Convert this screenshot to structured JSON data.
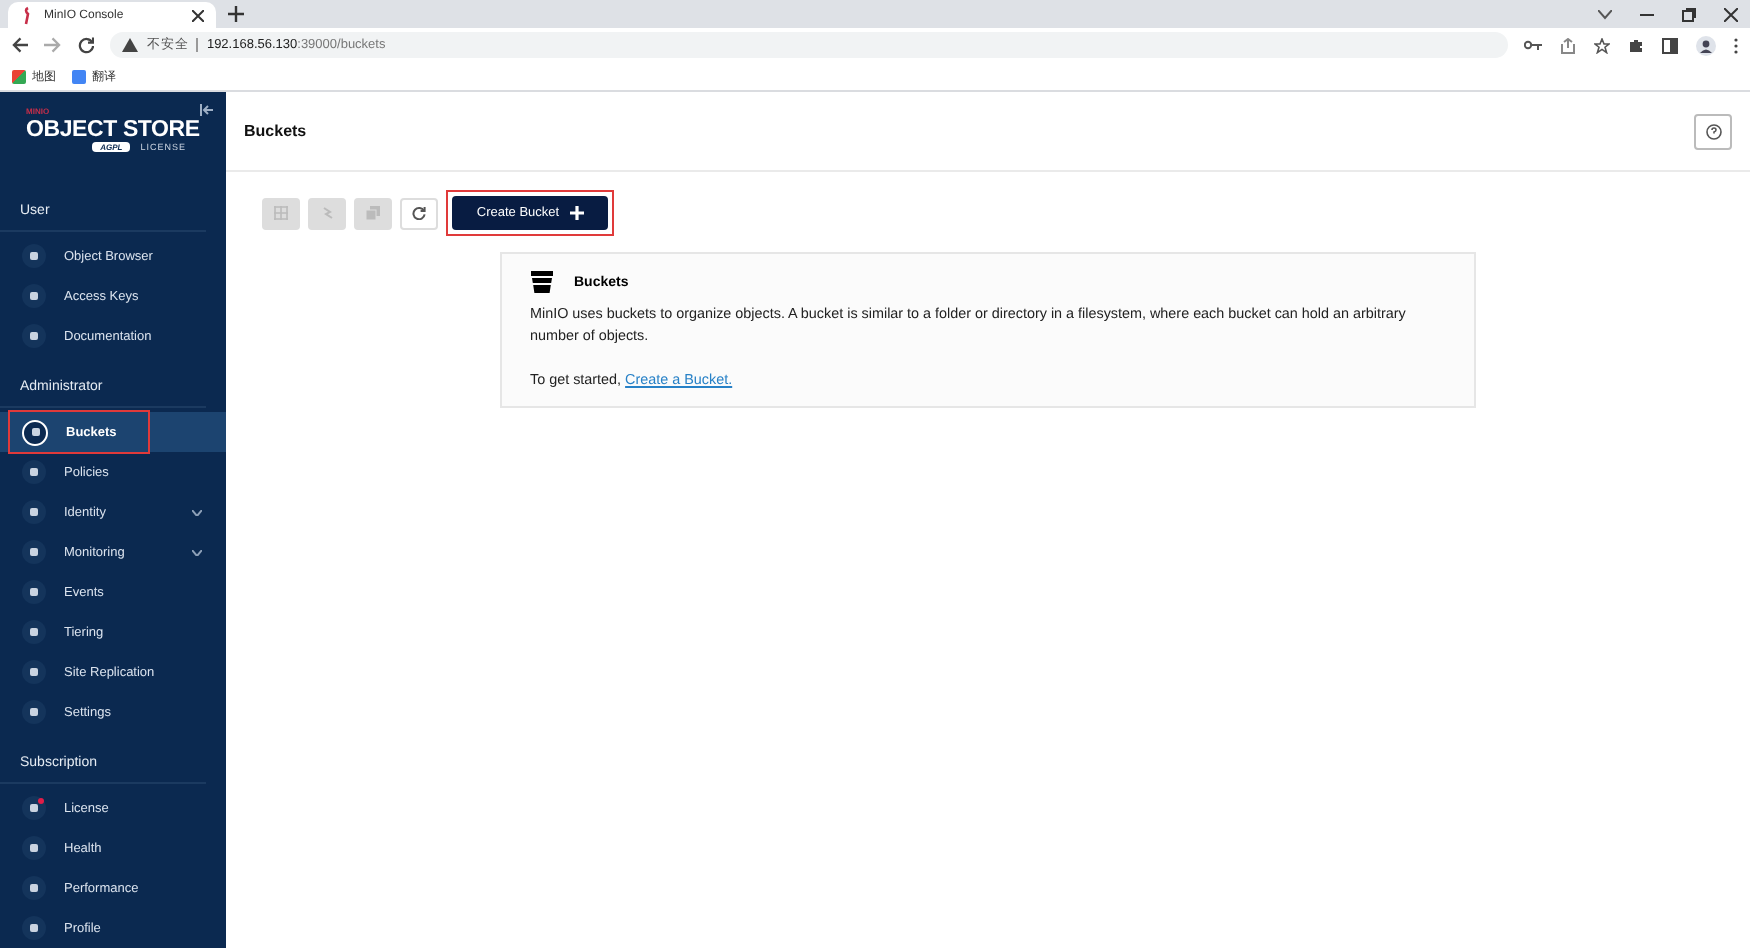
{
  "browser": {
    "tab_title": "MinIO Console",
    "security_label": "不安全",
    "url_host": "192.168.56.130",
    "url_rest": ":39000/buckets",
    "bookmarks": [
      {
        "label": "地图"
      },
      {
        "label": "翻译"
      }
    ]
  },
  "sidebar": {
    "brand_top": "MINIO",
    "brand_title": "OBJECT STORE",
    "brand_badge": "AGPL",
    "brand_sub": "LICENSE",
    "sections": [
      {
        "title": "User",
        "items": [
          {
            "label": "Object Browser",
            "selected": false,
            "expandable": false,
            "badge": false,
            "annotated": false
          },
          {
            "label": "Access Keys",
            "selected": false,
            "expandable": false,
            "badge": false,
            "annotated": false
          },
          {
            "label": "Documentation",
            "selected": false,
            "expandable": false,
            "badge": false,
            "annotated": false
          }
        ]
      },
      {
        "title": "Administrator",
        "items": [
          {
            "label": "Buckets",
            "selected": true,
            "expandable": false,
            "badge": false,
            "annotated": true
          },
          {
            "label": "Policies",
            "selected": false,
            "expandable": false,
            "badge": false,
            "annotated": false
          },
          {
            "label": "Identity",
            "selected": false,
            "expandable": true,
            "badge": false,
            "annotated": false
          },
          {
            "label": "Monitoring",
            "selected": false,
            "expandable": true,
            "badge": false,
            "annotated": false
          },
          {
            "label": "Events",
            "selected": false,
            "expandable": false,
            "badge": false,
            "annotated": false
          },
          {
            "label": "Tiering",
            "selected": false,
            "expandable": false,
            "badge": false,
            "annotated": false
          },
          {
            "label": "Site Replication",
            "selected": false,
            "expandable": false,
            "badge": false,
            "annotated": false
          },
          {
            "label": "Settings",
            "selected": false,
            "expandable": false,
            "badge": false,
            "annotated": false
          }
        ]
      },
      {
        "title": "Subscription",
        "items": [
          {
            "label": "License",
            "selected": false,
            "expandable": false,
            "badge": true,
            "annotated": false
          },
          {
            "label": "Health",
            "selected": false,
            "expandable": false,
            "badge": false,
            "annotated": false
          },
          {
            "label": "Performance",
            "selected": false,
            "expandable": false,
            "badge": false,
            "annotated": false
          },
          {
            "label": "Profile",
            "selected": false,
            "expandable": false,
            "badge": false,
            "annotated": false
          }
        ]
      }
    ]
  },
  "page": {
    "title": "Buckets",
    "toolbar": [
      {
        "kind": "grid",
        "disabled": true
      },
      {
        "kind": "lines",
        "disabled": true
      },
      {
        "kind": "stack",
        "disabled": true
      },
      {
        "kind": "refresh",
        "disabled": false
      }
    ],
    "create_button": {
      "label": "Create Bucket",
      "annotated": true
    },
    "info": {
      "title": "Buckets",
      "text": "MinIO uses buckets to organize objects. A bucket is similar to a folder or directory in a filesystem, where each bucket can hold an arbitrary number of objects.",
      "prompt": "To get started,",
      "link": "Create a Bucket."
    }
  }
}
